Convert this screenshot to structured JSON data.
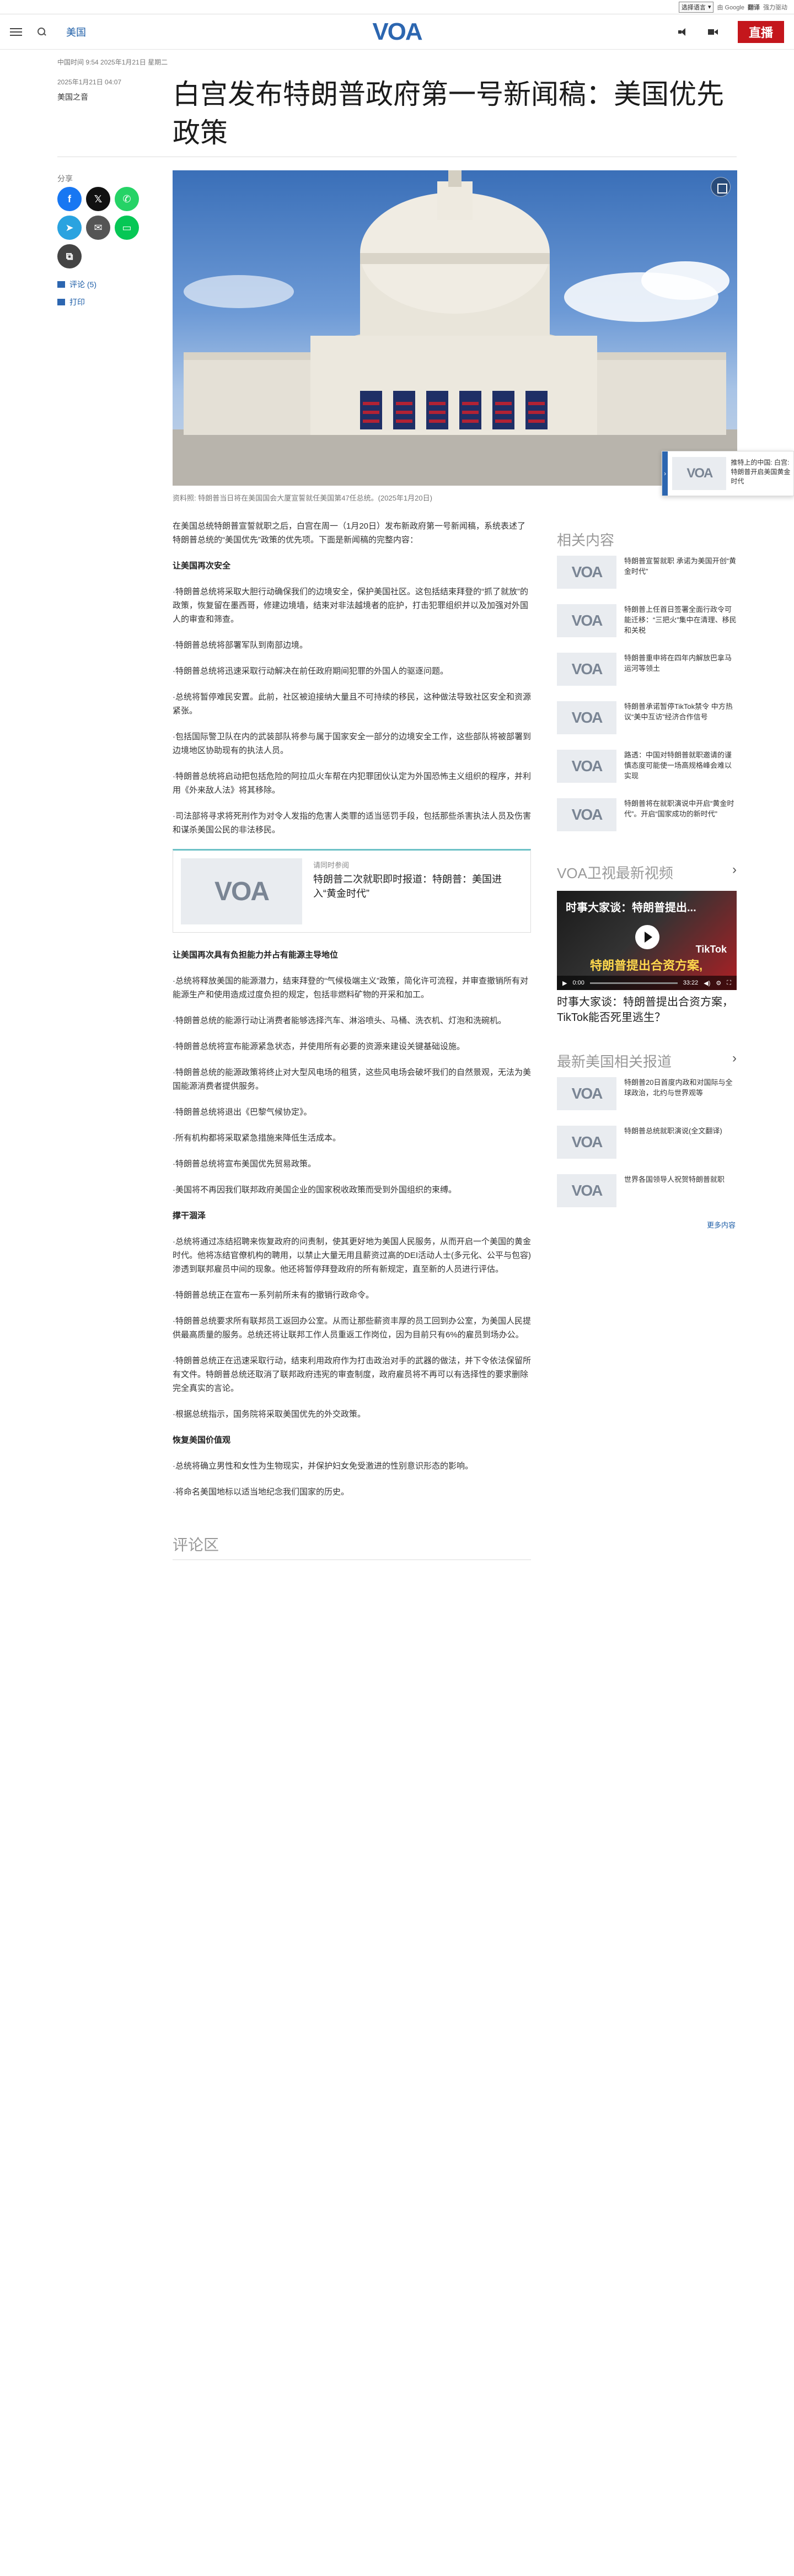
{
  "translate_bar": {
    "select_label": "选择语言",
    "powered": "由 Google",
    "gt_label": "翻译",
    "brand": "强力驱动"
  },
  "header": {
    "section": "美国",
    "logo": "VOA",
    "live_label": "直播"
  },
  "article": {
    "breadcrumb": "中国时间 9:54 2025年1月21日 星期二",
    "date": "2025年1月21日 04:07",
    "author": "美国之音",
    "title": "白宫发布特朗普政府第一号新闻稿：美国优先政策",
    "share_label": "分享",
    "comments_link": "评论 (5)",
    "print_link": "打印",
    "caption": "资料照: 特朗普当日将在美国国会大厦宣誓就任美国第47任总统。(2025年1月20日)",
    "paragraphs": [
      "在美国总统特朗普宣誓就职之后，白宫在周一（1月20日）发布新政府第一号新闻稿，系统表述了特朗普总统的“美国优先”政策的优先项。下面是新闻稿的完整内容："
    ],
    "sections": [
      {
        "heading": "让美国再次安全",
        "items": [
          "·特朗普总统将采取大胆行动确保我们的边境安全，保护美国社区。这包括结束拜登的“抓了就放”的政策，恢复留在墨西哥，修建边境墙，结束对非法越境者的庇护，打击犯罪组织并以及加强对外国人的审查和筛查。",
          "·特朗普总统将部署军队到南部边境。",
          "·特朗普总统将迅速采取行动解决在前任政府期间犯罪的外国人的驱逐问题。",
          "·总统将暂停难民安置。此前，社区被迫接纳大量且不可持续的移民，这种做法导致社区安全和资源紧张。",
          "·包括国际警卫队在内的武装部队将参与属于国家安全一部分的边境安全工作，这些部队将被部署到边境地区协助现有的执法人员。",
          "·特朗普总统将启动把包括危险的阿拉瓜火车帮在内犯罪团伙认定为外国恐怖主义组织的程序，并利用《外来敌人法》将其移除。",
          "·司法部将寻求将死刑作为对令人发指的危害人类罪的适当惩罚手段，包括那些杀害执法人员及伤害和谋杀美国公民的非法移民。"
        ]
      },
      {
        "heading": "让美国再次具有负担能力并占有能源主导地位",
        "items": [
          "·总统将释放美国的能源潜力，结束拜登的“气候极端主义”政策，简化许可流程，并审查撤销所有对能源生产和使用造成过度负担的规定，包括非燃料矿物的开采和加工。",
          "·特朗普总统的能源行动让消费者能够选择汽车、淋浴喷头、马桶、洗衣机、灯泡和洗碗机。",
          "·特朗普总统将宣布能源紧急状态，并使用所有必要的资源来建设关键基础设施。",
          "·特朗普总统的能源政策将终止对大型风电场的租赁，这些风电场会破坏我们的自然景观，无法为美国能源消费者提供服务。",
          "·特朗普总统将退出《巴黎气候协定》。",
          "·所有机构都将采取紧急措施来降低生活成本。",
          "·特朗普总统将宣布美国优先贸易政策。",
          "·美国将不再因我们联邦政府美国企业的国家税收政策而受到外国组织的束缚。"
        ]
      },
      {
        "heading": "撑干涸泽",
        "items": [
          "·总统将通过冻结招聘来恢复政府的问责制，使其更好地为美国人民服务，从而开启一个美国的黄金时代。他将冻结官僚机构的聘用，以禁止大量无用且薪资过高的DEI活动人士(多元化、公平与包容)渗透到联邦雇员中间的现象。他还将暂停拜登政府的所有新规定，直至新的人员进行评估。",
          "·特朗普总统正在宣布一系列前所未有的撤销行政命令。",
          "·特朗普总统要求所有联邦员工返回办公室。从而让那些薪资丰厚的员工回到办公室，为美国人民提供最高质量的服务。总统还将让联邦工作人员重返工作岗位，因为目前只有6%的雇员到场办公。",
          "·特朗普总统正在迅速采取行动，结束利用政府作为打击政治对手的武器的做法，并下令依法保留所有文件。特朗普总统还取消了联邦政府违宪的审查制度，政府雇员将不再可以有选择性的要求删除完全真实的言论。",
          "·根据总统指示，国务院将采取美国优先的外交政策。"
        ]
      },
      {
        "heading": "恢复美国价值观",
        "items": [
          "·总统将确立男性和女性为生物现实，并保护妇女免受激进的性别意识形态的影响。",
          "·将命名美国地标以适当地纪念我们国家的历史。"
        ]
      }
    ],
    "related_box": {
      "label": "请同时参阅",
      "title": "特朗普二次就职即时报道：特朗普：美国进入“黄金时代”"
    },
    "comments_heading": "评论区"
  },
  "sidebar": {
    "related_heading": "相关内容",
    "related": [
      "特朗普宣誓就职 承诺为美国开创“黄金时代”",
      "特朗普上任首日签署全面行政令可能迁移：“三把火”集中在清理、移民和关税",
      "特朗普重申将在四年内解放巴拿马运河等领土",
      "特朗普承诺暂停TikTok禁令 中方热议“美中互访”经济合作信号",
      "路透：中国对特朗普就职邀请的谨慎态度可能使一场高规格峰会难以实现",
      "特朗普将在就职演说中开启“黄金时代”。开启“国家成功的新时代”"
    ],
    "video_heading": "VOA卫视最新视频",
    "video": {
      "overlay_title": "时事大家谈：特朗普提出...",
      "overlay_sub": "特朗普提出合资方案,",
      "badge": "TikTok",
      "time_current": "0:00",
      "time_total": "33:22",
      "caption": "时事大家谈：特朗普提出合资方案，TikTok能否死里逃生？"
    },
    "latest_heading": "最新美国相关报道",
    "latest": [
      "特朗普20日首度内政和对国际与全球政治，北约与世界观等",
      "特朗普总统就职演说(全文翻译)",
      "世界各国领导人祝贺特朗普就职"
    ],
    "more_label": "更多内容"
  },
  "popup": {
    "text": "推特上的中国: 白宫: 特朗普开启美国黄金时代",
    "side_label": "›"
  },
  "share_buttons": [
    {
      "name": "facebook-share-button",
      "glyph": "f",
      "color": "#1877f2"
    },
    {
      "name": "x-share-button",
      "glyph": "𝕏",
      "color": "#111111"
    },
    {
      "name": "whatsapp-share-button",
      "glyph": "✆",
      "color": "#25d366"
    },
    {
      "name": "telegram-share-button",
      "glyph": "➤",
      "color": "#2aa3e0"
    },
    {
      "name": "email-share-button",
      "glyph": "✉",
      "color": "#555555"
    },
    {
      "name": "line-share-button",
      "glyph": "▭",
      "color": "#06c755"
    },
    {
      "name": "copy-link-button",
      "glyph": "⧉",
      "color": "#444444"
    }
  ]
}
